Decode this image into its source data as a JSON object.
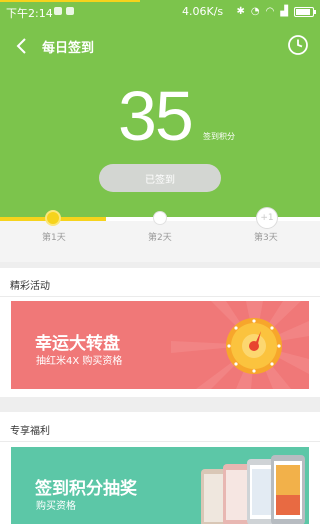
{
  "status_bar": {
    "time": "下午2:14",
    "net_speed": "4.06K/s"
  },
  "header": {
    "title": "每日签到",
    "points": "35",
    "points_label": "签到积分",
    "signed_button": "已签到"
  },
  "days": {
    "items": [
      {
        "label": "第1天",
        "state": "done"
      },
      {
        "label": "第2天",
        "state": "pending"
      },
      {
        "label": "第3天",
        "state": "bonus",
        "badge": "+1"
      }
    ],
    "progress_fraction": 0.33
  },
  "activities": {
    "title": "精彩活动",
    "banner": {
      "title": "幸运大转盘",
      "subtitle": "抽红米4X 购买资格",
      "color": "#f07878"
    }
  },
  "benefits": {
    "title": "专享福利",
    "banner": {
      "title": "签到积分抽奖",
      "subtitle": "购买资格",
      "color": "#5cc7a7"
    }
  },
  "colors": {
    "accent_green": "#7cc44c",
    "progress_yellow": "#f6d31c"
  }
}
